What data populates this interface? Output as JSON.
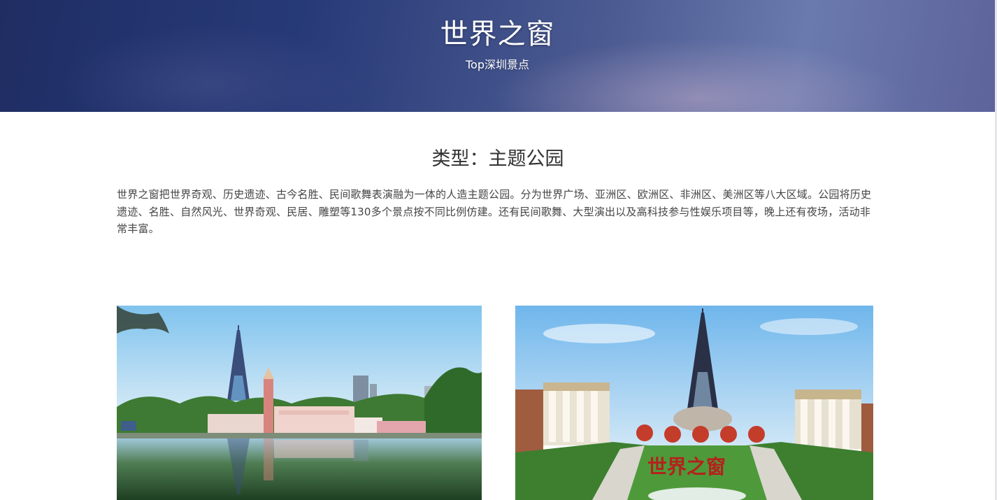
{
  "hero": {
    "title": "世界之窗",
    "subtitle": "Top深圳景点"
  },
  "attraction": {
    "type_label": "类型：主题公园",
    "description": "世界之窗把世界奇观、历史遗迹、古今名胜、民间歌舞表演融为一体的人造主题公园。分为世界广场、亚洲区、欧洲区、非洲区、美洲区等八大区域。公园将历史遗迹、名胜、自然风光、世界奇观、民居、雕塑等130多个景点按不同比例仿建。还有民间歌舞、大型演出以及高科技参与性娱乐项目等，晚上还有夜场，活动非常丰富。"
  },
  "gallery": {
    "images": [
      {
        "name": "eiffel-tower-lake-photo"
      },
      {
        "name": "eiffel-tower-plaza-photo",
        "sign_text": "世界之窗"
      }
    ]
  },
  "colors": {
    "hero_dark": "#1f2d63",
    "hero_light": "#6a7aae",
    "text": "#333333"
  }
}
